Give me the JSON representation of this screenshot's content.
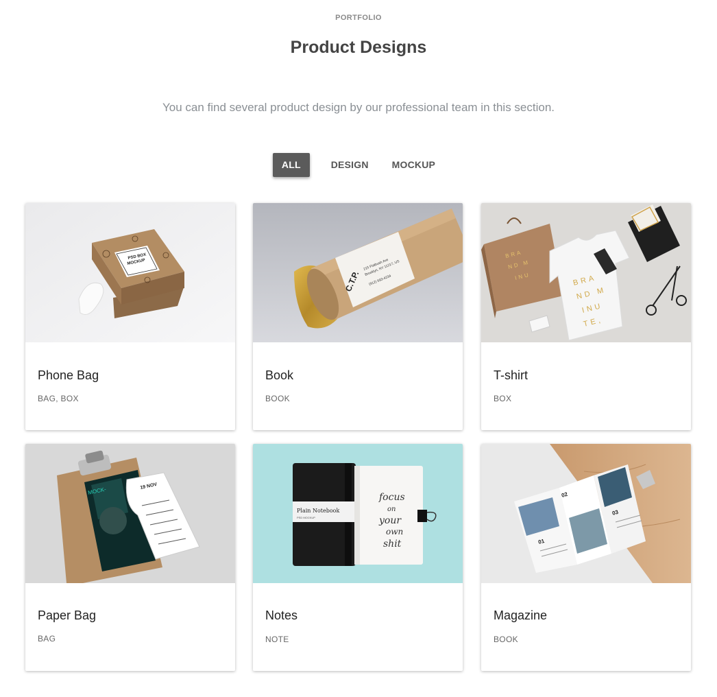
{
  "header": {
    "eyebrow": "PORTFOLIO",
    "title": "Product Designs",
    "subtitle": "You can find several product design by our professional team in this section."
  },
  "filters": {
    "all": "ALL",
    "design": "DESIGN",
    "mockup": "MOCKUP",
    "active": "ALL"
  },
  "colors": {
    "active_filter_bg": "#5b5b5b",
    "card_bg": "#ffffff"
  },
  "portfolio": {
    "items": [
      {
        "name": "Phone Bag",
        "tags": "BAG, BOX",
        "image": "kraft-box-mockup"
      },
      {
        "name": "Book",
        "tags": "BOOK",
        "image": "kraft-tube-mockup"
      },
      {
        "name": "T-shirt",
        "tags": "BOX",
        "image": "branding-tshirt-mockup"
      },
      {
        "name": "Paper Bag",
        "tags": "BAG",
        "image": "clipboard-poster-mockup"
      },
      {
        "name": "Notes",
        "tags": "NOTE",
        "image": "notebook-mockup"
      },
      {
        "name": "Magazine",
        "tags": "BOOK",
        "image": "trifold-magazine-mockup"
      }
    ]
  },
  "image_text": {
    "box_label_1": "PSD BOX",
    "box_label_2": "MOCKUP",
    "tube_brand": "C.T.P.",
    "tube_address_1": "215 Flatbush Ave",
    "tube_address_2": "Brooklyn, NY 11217, US",
    "tube_phone": "(912) 693-4234",
    "tshirt_brand_1": "BRA",
    "tshirt_brand_2": "ND M",
    "tshirt_brand_3": "INU",
    "tshirt_brand_4": "TE,",
    "poster_date": "19 NOV",
    "notebook_title": "Plain Notebook",
    "notebook_sub": "PSD MOCKUP",
    "notebook_script_1": "focus",
    "notebook_script_2": "on",
    "notebook_script_3": "your",
    "notebook_script_4": "own",
    "notebook_script_5": "shit",
    "mag_num_1": "01",
    "mag_num_2": "02",
    "mag_num_3": "03"
  }
}
